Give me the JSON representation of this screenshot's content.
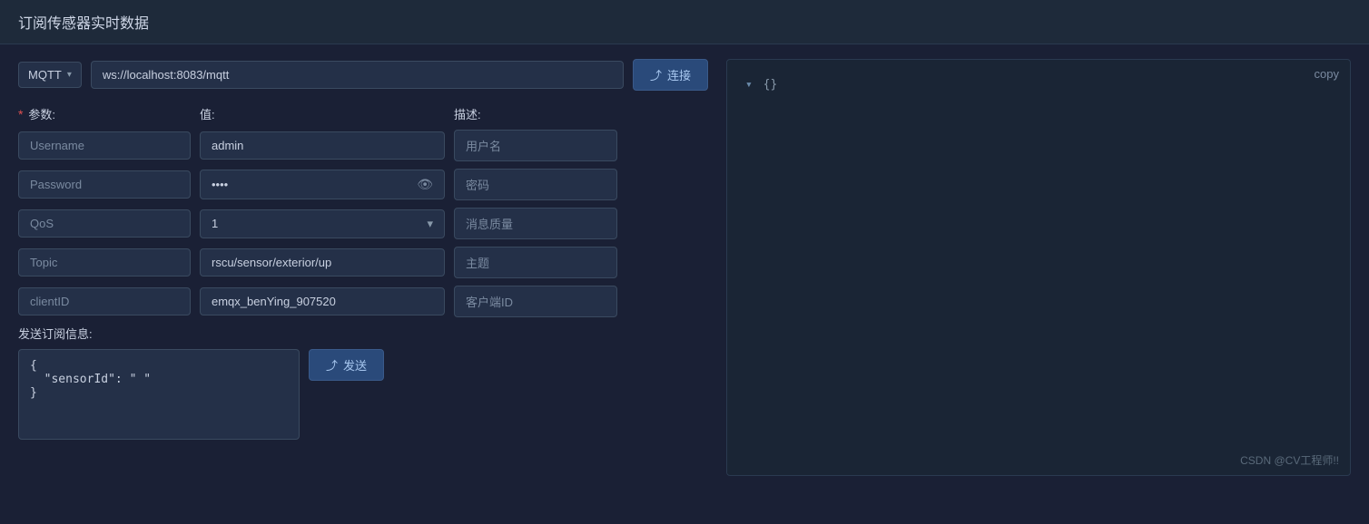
{
  "header": {
    "title": "订阅传感器实时数据"
  },
  "connection": {
    "protocol": "MQTT",
    "url": "ws://localhost:8083/mqtt",
    "connect_label": "连接",
    "connect_icon": "▷"
  },
  "form": {
    "headers": {
      "param": "* 参数:",
      "value": "值:",
      "desc": "描述:"
    },
    "required_mark": "*",
    "rows": [
      {
        "param": "Username",
        "value": "admin",
        "value_type": "text",
        "desc": "用户名"
      },
      {
        "param": "Password",
        "value": "••••",
        "value_type": "password",
        "desc": "密码"
      },
      {
        "param": "QoS",
        "value": "1",
        "value_type": "select",
        "desc": "消息质量"
      },
      {
        "param": "Topic",
        "value": "rscu/sensor/exterior/up",
        "value_type": "text",
        "desc": "主题"
      },
      {
        "param": "clientID",
        "value": "emqx_benYing_907520",
        "value_type": "text",
        "desc": "客户端ID"
      }
    ]
  },
  "subscribe": {
    "label": "发送订阅信息:",
    "json_content": "{\n  \"sensorId\": \" \"\n}",
    "send_label": "发送",
    "send_icon": "▷"
  },
  "right_panel": {
    "copy_label": "copy",
    "json_preview": "{}",
    "watermark": "CSDN @CV工程师!!"
  }
}
